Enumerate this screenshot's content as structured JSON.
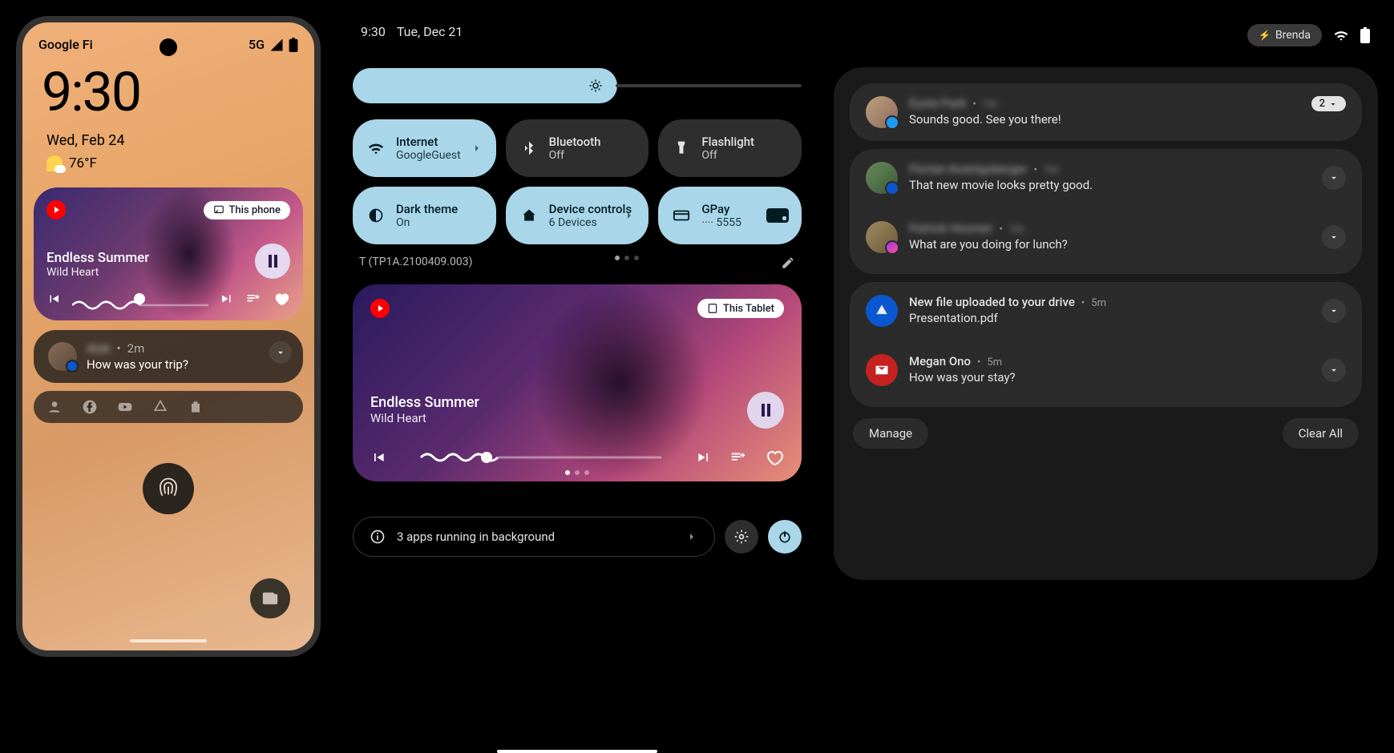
{
  "phone": {
    "carrier": "Google Fi",
    "network": "5G",
    "clock": "9:30",
    "date": "Wed, Feb 24",
    "temperature": "76°F",
    "media": {
      "cast": "This phone",
      "track_title": "Endless Summer",
      "track_artist": "Wild Heart"
    },
    "notif": {
      "sender": "Alok",
      "time": "2m",
      "text": "How was your trip?"
    }
  },
  "tablet": {
    "clock": "9:30",
    "date": "Tue, Dec 21",
    "build": "T (TP1A.2100409.003)",
    "tiles": {
      "internet": {
        "label": "Internet",
        "sub": "GoogleGuest"
      },
      "bluetooth": {
        "label": "Bluetooth",
        "sub": "Off"
      },
      "flashlight": {
        "label": "Flashlight",
        "sub": "Off"
      },
      "dark_theme": {
        "label": "Dark theme",
        "sub": "On"
      },
      "device_controls": {
        "label": "Device controls",
        "sub": "6 Devices"
      },
      "gpay": {
        "label": "GPay",
        "sub": "···· 5555"
      }
    },
    "media": {
      "cast": "This Tablet",
      "track_title": "Endless Summer",
      "track_artist": "Wild Heart"
    },
    "bg_apps": "3 apps running in background",
    "user_chip": "Brenda"
  },
  "notifs": [
    {
      "sender": "Eunie Park",
      "time": "1m",
      "text": "Sounds good. See you there!",
      "count": "2"
    },
    {
      "sender": "Florian Koenigsberger",
      "time": "1m",
      "text": "That new movie looks pretty good."
    },
    {
      "sender": "Patrick Hosmer",
      "time": "1m",
      "text": "What are you doing for lunch?"
    },
    {
      "title": "New file uploaded to your drive",
      "time": "5m",
      "text": "Presentation.pdf"
    },
    {
      "sender": "Megan Ono",
      "time": "5m",
      "text": "How was your stay?"
    }
  ],
  "actions": {
    "manage": "Manage",
    "clear": "Clear All"
  }
}
